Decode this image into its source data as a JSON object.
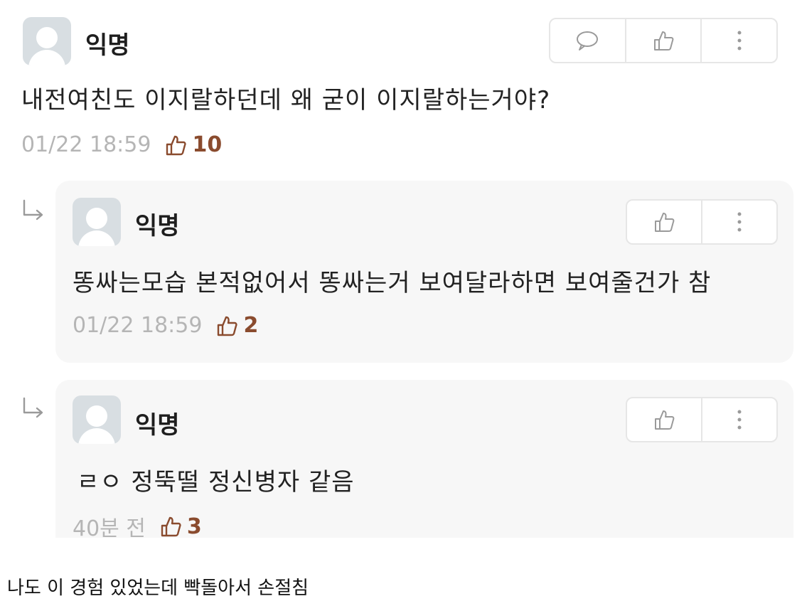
{
  "comments": [
    {
      "author": "익명",
      "content": "내전여친도 이지랄하던데 왜 굳이 이지랄하는거야?",
      "time": "01/22 18:59",
      "likes": "10"
    }
  ],
  "replies": [
    {
      "author": "익명",
      "content": "똥싸는모습 본적없어서 똥싸는거 보여달라하면 보여줄건가 참",
      "time": "01/22 18:59",
      "likes": "2"
    },
    {
      "author": "익명",
      "content": "ㄹㅇ 정뚝떨 정신병자 같음",
      "time": "40분 전",
      "likes": "3"
    }
  ],
  "caption": "나도 이 경험 있었는데 빡돌아서 손절침",
  "colors": {
    "like_accent": "#8a4b2e",
    "meta_gray": "#b5b5b5",
    "reply_bg": "#f7f7f7",
    "avatar_bg": "#d8dee2"
  },
  "icons": {
    "comment": "speech-bubble-icon",
    "like": "thumbs-up-icon",
    "more": "vertical-dots-icon",
    "reply": "reply-arrow-icon"
  }
}
